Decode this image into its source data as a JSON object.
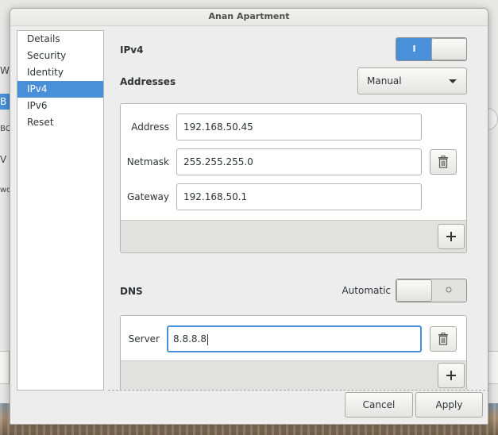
{
  "dialog": {
    "title": "Anan Apartment"
  },
  "sidebar": {
    "items": [
      {
        "label": "Details"
      },
      {
        "label": "Security"
      },
      {
        "label": "Identity"
      },
      {
        "label": "IPv4",
        "selected": true
      },
      {
        "label": "IPv6"
      },
      {
        "label": "Reset"
      }
    ]
  },
  "ipv4": {
    "heading": "IPv4",
    "enabled": true,
    "switch_on_glyph": "I",
    "switch_off_glyph": "O",
    "addresses_label": "Addresses",
    "method": "Manual",
    "address_label": "Address",
    "address_value": "192.168.50.45",
    "netmask_label": "Netmask",
    "netmask_value": "255.255.255.0",
    "gateway_label": "Gateway",
    "gateway_value": "192.168.50.1"
  },
  "dns": {
    "heading": "DNS",
    "automatic_label": "Automatic",
    "automatic_enabled": false,
    "switch_off_glyph": "O",
    "server_label": "Server",
    "server_value": "8.8.8.8"
  },
  "footer": {
    "cancel_label": "Cancel",
    "apply_label": "Apply"
  },
  "background": {
    "fragments": [
      "W",
      "B W",
      "BC",
      "V",
      "wo"
    ]
  },
  "colors": {
    "accent": "#4a90d9",
    "window_bg": "#ededed"
  },
  "icons": {
    "delete": "trash-icon",
    "add": "plus-icon",
    "dropdown": "chevron-down-icon"
  }
}
